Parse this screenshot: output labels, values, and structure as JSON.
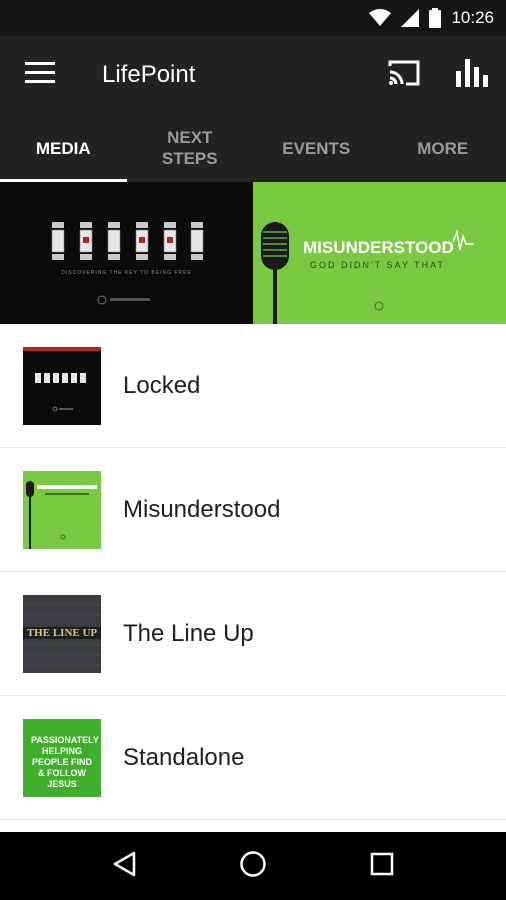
{
  "status": {
    "time": "10:26",
    "icons": [
      "wifi-icon",
      "signal-icon",
      "battery-icon"
    ]
  },
  "app_bar": {
    "title": "LifePoint",
    "icons": [
      "menu-icon",
      "cast-icon",
      "equalizer-icon"
    ]
  },
  "tabs": [
    {
      "label": "MEDIA",
      "active": true
    },
    {
      "label": "NEXT STEPS",
      "active": false
    },
    {
      "label": "EVENTS",
      "active": false
    },
    {
      "label": "MORE",
      "active": false
    }
  ],
  "banner": {
    "locked": {
      "subtitle": "DISCOVERING THE KEY TO BEING FREE"
    },
    "misunderstood": {
      "title": "MISUNDERSTOOD",
      "subtitle": "GOD DIDN'T SAY THAT"
    }
  },
  "series": [
    {
      "label": "Locked",
      "thumb": "locked"
    },
    {
      "label": "Misunderstood",
      "thumb": "misunderstood"
    },
    {
      "label": "The Line Up",
      "thumb": "lineup",
      "thumb_text": "THE LINE UP"
    },
    {
      "label": "Standalone",
      "thumb": "standalone",
      "thumb_text": "PASSIONATELY HELPING PEOPLE FIND & FOLLOW JESUS"
    }
  ],
  "colors": {
    "app_bar": "#222222",
    "status_bar": "#161616",
    "accent_green": "#7ac943",
    "nav_bar": "#000000"
  },
  "nav": [
    "back-icon",
    "home-icon",
    "recents-icon"
  ]
}
